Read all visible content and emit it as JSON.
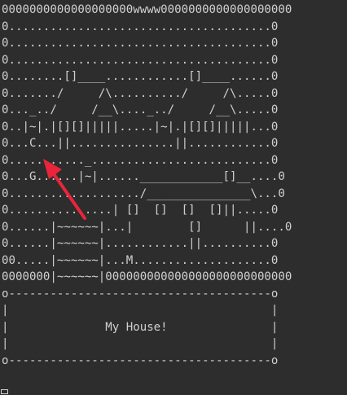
{
  "map": {
    "lines": [
      "0000000000000000000wwww0000000000000000000",
      "0......................................0",
      "0......................................0",
      "0......................................0",
      "0........[]____............[]____......0",
      "0......./     /\\........../     /\\.....0",
      "0..._../     /__\\...._../     /__\\.....0",
      "0..|~|.|[][]|||||.....|~|.|[][]|||||...0",
      "0...C...||...............||............0",
      "0..........._..........................0",
      "0...G......|~|......____________[]__....0",
      "0.................../_______________\\...0",
      "0...............| []  []  []  []||.....0",
      "0......|~~~~~~|...|        []      ||....0",
      "0......|~~~~~~|............||..........0",
      "00.....|~~~~~~|...M....................0",
      "0000000|~~~~~~|000000000000000000000000000",
      "o--------------------------------------o",
      "|                                      |",
      "|              My House!               |",
      "|                                      |",
      "o--------------------------------------o"
    ]
  },
  "dialog": {
    "title": "My House!"
  },
  "annotation": {
    "arrow_color": "#e8253a",
    "target": "C"
  },
  "colors": {
    "background": "#2d2d2d",
    "text": "#d0d0d0"
  }
}
